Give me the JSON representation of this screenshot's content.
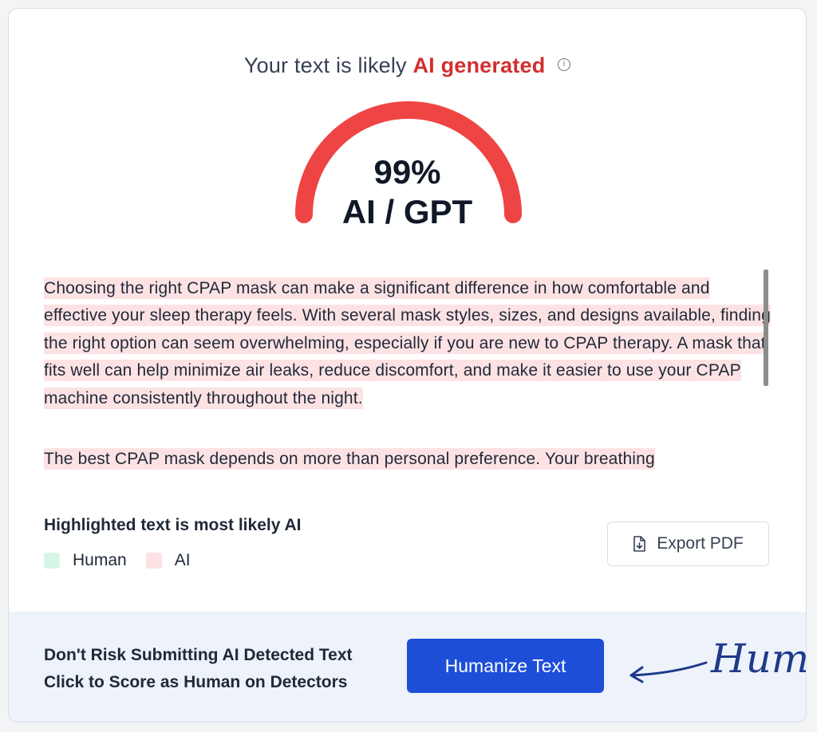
{
  "headline": {
    "prefix": "Your text is likely",
    "verdict": "AI generated"
  },
  "gauge": {
    "percent_label": "99%",
    "type_label": "AI / GPT",
    "value": 0.99,
    "color": "#ef4444"
  },
  "text_panel": {
    "paragraphs": [
      " Choosing the right CPAP mask can make a significant difference in how comfortable and effective your sleep therapy feels.  With several mask styles, sizes, and designs available, finding the right option can seem overwhelming, especially if you are new to CPAP therapy.  A mask that fits well can help minimize air leaks, reduce discomfort, and make it easier to use your CPAP machine consistently throughout the night.",
      " The best CPAP mask depends on more than personal preference.  Your breathing"
    ]
  },
  "legend": {
    "title": "Highlighted text is most likely AI",
    "human_label": "Human",
    "ai_label": "AI",
    "human_color": "#d8f6e8",
    "ai_color": "#fde2e4"
  },
  "export": {
    "label": "Export PDF"
  },
  "footer": {
    "line1": "Don't Risk Submitting AI Detected Text",
    "line2": "Click to Score as Human on Detectors",
    "button_label": "Humanize Text",
    "annotation": "Human"
  }
}
